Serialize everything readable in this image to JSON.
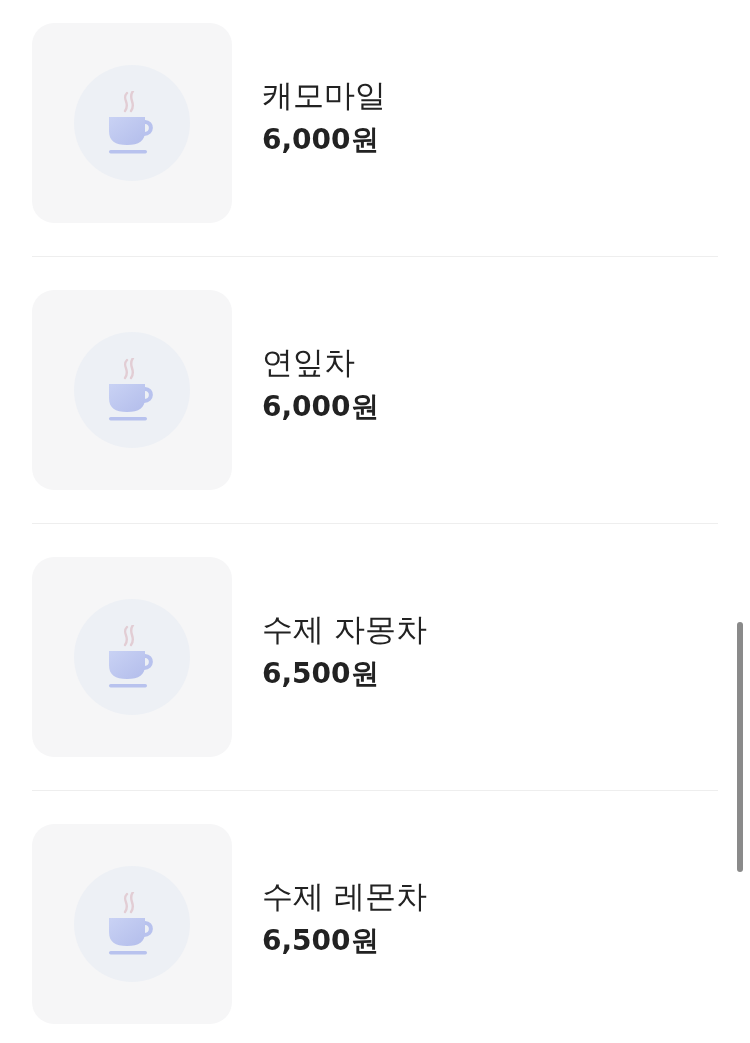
{
  "items": [
    {
      "name": "캐모마일",
      "price": "6,000원"
    },
    {
      "name": "연잎차",
      "price": "6,000원"
    },
    {
      "name": "수제 자몽차",
      "price": "6,500원"
    },
    {
      "name": "수제 레몬차",
      "price": "6,500원"
    }
  ]
}
